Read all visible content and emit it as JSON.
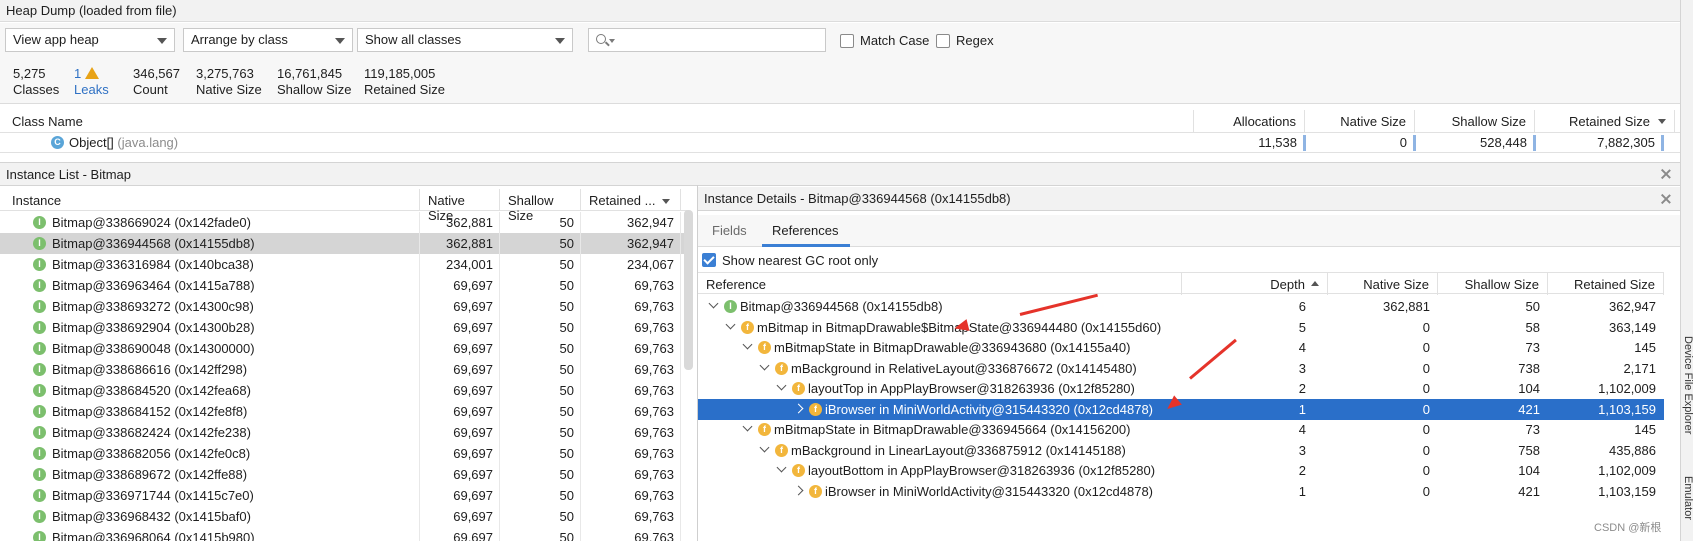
{
  "window": {
    "title": "Heap Dump (loaded from file)"
  },
  "toolbar": {
    "heap_select": "View app heap",
    "arrange_select": "Arrange by class",
    "filter_select": "Show all classes",
    "search_placeholder": "",
    "match_case_label": "Match Case",
    "regex_label": "Regex"
  },
  "stats": {
    "classes_value": "5,275",
    "classes_label": "Classes",
    "leaks_value": "1",
    "leaks_label": "Leaks",
    "count_value": "346,567",
    "count_label": "Count",
    "native_value": "3,275,763",
    "native_label": "Native Size",
    "shallow_value": "16,761,845",
    "shallow_label": "Shallow Size",
    "retained_value": "119,185,005",
    "retained_label": "Retained Size"
  },
  "class_table": {
    "headers": {
      "name": "Class Name",
      "allocations": "Allocations",
      "native": "Native Size",
      "shallow": "Shallow Size",
      "retained": "Retained Size"
    },
    "row": {
      "name": "Object[]",
      "package": "(java.lang)",
      "allocations": "11,538",
      "native": "0",
      "shallow": "528,448",
      "retained": "7,882,305"
    }
  },
  "instance_list": {
    "title": "Instance List - Bitmap",
    "headers": {
      "instance": "Instance",
      "native": "Native Size",
      "shallow": "Shallow Size",
      "retained": "Retained ..."
    },
    "rows": [
      {
        "name": "Bitmap@338669024 (0x142fade0)",
        "native": "362,881",
        "shallow": "50",
        "retained": "362,947"
      },
      {
        "name": "Bitmap@336944568 (0x14155db8)",
        "native": "362,881",
        "shallow": "50",
        "retained": "362,947"
      },
      {
        "name": "Bitmap@336316984 (0x140bca38)",
        "native": "234,001",
        "shallow": "50",
        "retained": "234,067"
      },
      {
        "name": "Bitmap@336963464 (0x1415a788)",
        "native": "69,697",
        "shallow": "50",
        "retained": "69,763"
      },
      {
        "name": "Bitmap@338693272 (0x14300c98)",
        "native": "69,697",
        "shallow": "50",
        "retained": "69,763"
      },
      {
        "name": "Bitmap@338692904 (0x14300b28)",
        "native": "69,697",
        "shallow": "50",
        "retained": "69,763"
      },
      {
        "name": "Bitmap@338690048 (0x14300000)",
        "native": "69,697",
        "shallow": "50",
        "retained": "69,763"
      },
      {
        "name": "Bitmap@338686616 (0x142ff298)",
        "native": "69,697",
        "shallow": "50",
        "retained": "69,763"
      },
      {
        "name": "Bitmap@338684520 (0x142fea68)",
        "native": "69,697",
        "shallow": "50",
        "retained": "69,763"
      },
      {
        "name": "Bitmap@338684152 (0x142fe8f8)",
        "native": "69,697",
        "shallow": "50",
        "retained": "69,763"
      },
      {
        "name": "Bitmap@338682424 (0x142fe238)",
        "native": "69,697",
        "shallow": "50",
        "retained": "69,763"
      },
      {
        "name": "Bitmap@338682056 (0x142fe0c8)",
        "native": "69,697",
        "shallow": "50",
        "retained": "69,763"
      },
      {
        "name": "Bitmap@338689672 (0x142ffe88)",
        "native": "69,697",
        "shallow": "50",
        "retained": "69,763"
      },
      {
        "name": "Bitmap@336971744 (0x1415c7e0)",
        "native": "69,697",
        "shallow": "50",
        "retained": "69,763"
      },
      {
        "name": "Bitmap@336968432 (0x1415baf0)",
        "native": "69,697",
        "shallow": "50",
        "retained": "69,763"
      },
      {
        "name": "Bitmap@336968064 (0x1415b980)",
        "native": "69,697",
        "shallow": "50",
        "retained": "69,763"
      }
    ]
  },
  "instance_details": {
    "title": "Instance Details - Bitmap@336944568 (0x14155db8)",
    "tabs": [
      "Fields",
      "References"
    ],
    "gc_root_label": "Show nearest GC root only",
    "headers": {
      "reference": "Reference",
      "depth": "Depth",
      "native": "Native Size",
      "shallow": "Shallow Size",
      "retained": "Retained Size"
    },
    "rows": [
      {
        "text": "Bitmap@336944568 (0x14155db8)",
        "depth": "6",
        "native": "362,881",
        "shallow": "50",
        "retained": "362,947"
      },
      {
        "text": "mBitmap in BitmapDrawable$BitmapState@336944480 (0x14155d60)",
        "depth": "5",
        "native": "0",
        "shallow": "58",
        "retained": "363,149"
      },
      {
        "text": "mBitmapState in BitmapDrawable@336943680 (0x14155a40)",
        "depth": "4",
        "native": "0",
        "shallow": "73",
        "retained": "145"
      },
      {
        "text": "mBackground in RelativeLayout@336876672 (0x14145480)",
        "depth": "3",
        "native": "0",
        "shallow": "738",
        "retained": "2,171"
      },
      {
        "text": "layoutTop in AppPlayBrowser@318263936 (0x12f85280)",
        "depth": "2",
        "native": "0",
        "shallow": "104",
        "retained": "1,102,009"
      },
      {
        "text": "iBrowser in MiniWorldActivity@315443320 (0x12cd4878)",
        "depth": "1",
        "native": "0",
        "shallow": "421",
        "retained": "1,103,159"
      },
      {
        "text": "mBitmapState in BitmapDrawable@336945664 (0x14156200)",
        "depth": "4",
        "native": "0",
        "shallow": "73",
        "retained": "145"
      },
      {
        "text": "mBackground in LinearLayout@336875912 (0x14145188)",
        "depth": "3",
        "native": "0",
        "shallow": "758",
        "retained": "435,886"
      },
      {
        "text": "layoutBottom in AppPlayBrowser@318263936 (0x12f85280)",
        "depth": "2",
        "native": "0",
        "shallow": "104",
        "retained": "1,102,009"
      },
      {
        "text": "iBrowser in MiniWorldActivity@315443320 (0x12cd4878)",
        "depth": "1",
        "native": "0",
        "shallow": "421",
        "retained": "1,103,159"
      }
    ]
  },
  "sidebar": {
    "device_file_explorer": "Device File Explorer",
    "emulator": "Emulator"
  },
  "watermark": "CSDN @新根",
  "colors": {
    "selection": "#2a6fc9",
    "accent": "#3b7fd4",
    "annotation_arrow": "#e5332a",
    "warning": "#e8a317"
  }
}
